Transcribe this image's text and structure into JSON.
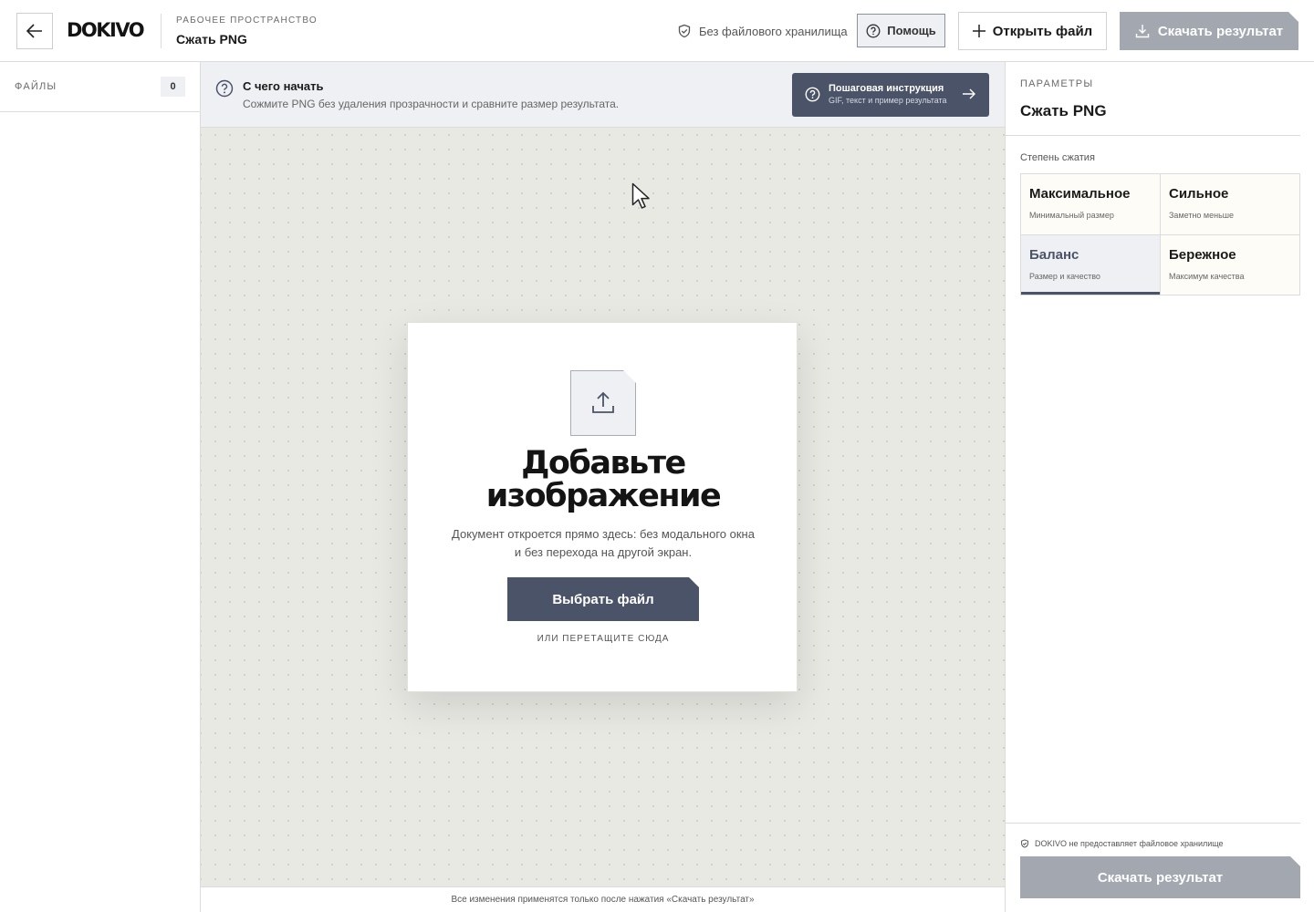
{
  "header": {
    "logo": "DOKIVO",
    "workspace_label": "РАБОЧЕЕ ПРОСТРАНСТВО",
    "workspace_title": "Сжать PNG",
    "storage_note": "Без файлового хранилища",
    "help_label": "Помощь",
    "open_file_label": "Открыть файл",
    "download_label": "Скачать результат"
  },
  "sidebar": {
    "files_label": "ФАЙЛЫ",
    "files_count": "0"
  },
  "start": {
    "title": "С чего начать",
    "description": "Сожмите PNG без удаления прозрачности и сравните размер результата.",
    "guide_title": "Пошаговая инструкция",
    "guide_subtitle": "GIF, текст и пример результата"
  },
  "upload": {
    "title_line1": "Добавьте",
    "title_line2": "изображение",
    "description": "Документ откроется прямо здесь: без модального окна и без перехода на другой экран.",
    "choose_label": "Выбрать файл",
    "drag_hint": "ИЛИ ПЕРЕТАЩИТЕ СЮДА"
  },
  "footer": {
    "note": "Все изменения применятся только после нажатия «Скачать результат»"
  },
  "params": {
    "label": "ПАРАМЕТРЫ",
    "title": "Сжать PNG",
    "compression_label": "Степень сжатия",
    "options": [
      {
        "title": "Максимальное",
        "subtitle": "Минимальный размер",
        "selected": false
      },
      {
        "title": "Сильное",
        "subtitle": "Заметно меньше",
        "selected": false
      },
      {
        "title": "Баланс",
        "subtitle": "Размер и качество",
        "selected": true
      },
      {
        "title": "Бережное",
        "subtitle": "Максимум качества",
        "selected": false
      }
    ],
    "storage_note": "DOKIVO не предоставляет файловое хранилище",
    "download_label": "Скачать результат"
  },
  "colors": {
    "accent": "#4a5368",
    "disabled": "#a3a8b0",
    "canvas": "#e9e9e4"
  },
  "icons": {
    "back": "arrow-left-icon",
    "shield": "shield-check-icon",
    "help": "question-circle-icon",
    "plus": "plus-icon",
    "download": "download-icon",
    "upload": "upload-icon",
    "arrow": "arrow-right-icon",
    "cursor": "mouse-cursor-icon"
  }
}
